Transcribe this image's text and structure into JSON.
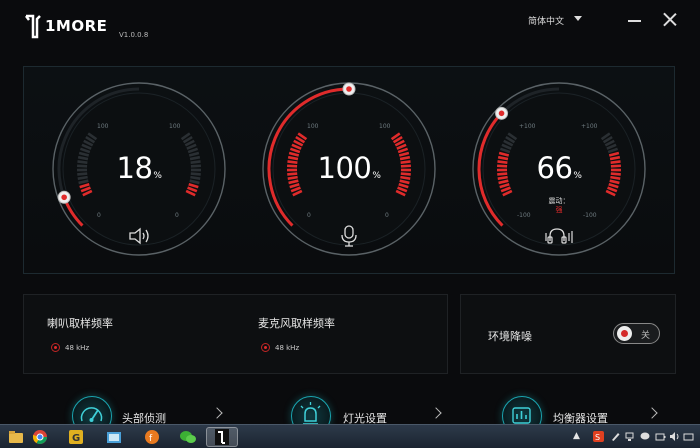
{
  "app": {
    "brand": "1MORE",
    "version": "V1.0.0.8",
    "language": "简体中文"
  },
  "gauges": [
    {
      "id": "speaker",
      "value": 18,
      "unit": "%",
      "scale_max": "100",
      "scale_min": "0",
      "icon": "speaker-icon"
    },
    {
      "id": "microphone",
      "value": 100,
      "unit": "%",
      "scale_max": "100",
      "scale_min": "0",
      "icon": "microphone-icon"
    },
    {
      "id": "anc",
      "value": 66,
      "unit": "%",
      "scale_max": "+100",
      "scale_min": "-100",
      "mode_label": "震动：",
      "mode_value": "强",
      "icon": "headphone-anc-icon"
    }
  ],
  "sample_rate": {
    "speaker_title": "喇叭取样频率",
    "speaker_rate": "48 kHz",
    "mic_title": "麦克风取样频率",
    "mic_rate": "48 kHz"
  },
  "noise_cancel": {
    "title": "环境降噪",
    "toggle_label": "关",
    "enabled": false
  },
  "nav": [
    {
      "label": "头部侦测",
      "icon": "head-tracking-icon"
    },
    {
      "label": "灯光设置",
      "icon": "light-icon"
    },
    {
      "label": "均衡器设置",
      "icon": "equalizer-icon"
    }
  ],
  "colors": {
    "accent_red": "#e02b2b",
    "accent_teal": "#1aa5b0",
    "background": "#0a0b0d"
  }
}
